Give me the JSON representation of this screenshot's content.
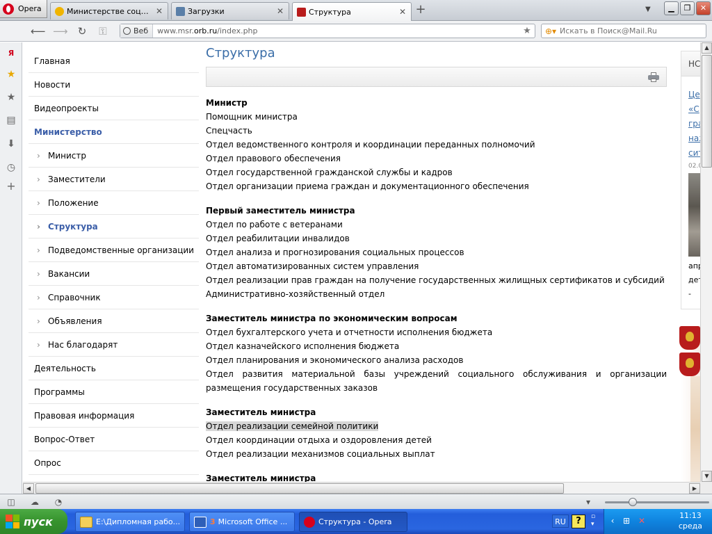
{
  "browser": {
    "menu_label": "Opera",
    "tabs": [
      {
        "label": "Министерстве социаль...",
        "close": "✕"
      },
      {
        "label": "Загрузки",
        "close": "✕"
      },
      {
        "label": "Структура",
        "close": "✕"
      }
    ],
    "new_tab": "+",
    "address": {
      "badge": "Веб",
      "url_prefix": "www.msr.",
      "url_domain": "orb.ru",
      "url_suffix": "/index.php"
    },
    "search": {
      "placeholder": "Искать в Поиск@Mail.Ru"
    }
  },
  "panel_icons": [
    "yandex-icon",
    "star-bookmarks-icon",
    "star-icon",
    "notes-icon",
    "downloads-icon",
    "history-icon",
    "add-panel-icon"
  ],
  "leftnav": {
    "items": [
      {
        "label": "Главная",
        "level": 0,
        "active": false
      },
      {
        "label": "Новости",
        "level": 0,
        "active": false
      },
      {
        "label": "Видеопроекты",
        "level": 0,
        "active": false
      },
      {
        "label": "Министерство",
        "level": 0,
        "active": true
      },
      {
        "label": "Министр",
        "level": 1,
        "active": false
      },
      {
        "label": "Заместители",
        "level": 1,
        "active": false
      },
      {
        "label": "Положение",
        "level": 1,
        "active": false
      },
      {
        "label": "Структура",
        "level": 1,
        "active": true
      },
      {
        "label": "Подведомственные организации",
        "level": 1,
        "active": false
      },
      {
        "label": "Вакансии",
        "level": 1,
        "active": false
      },
      {
        "label": "Справочник",
        "level": 1,
        "active": false
      },
      {
        "label": "Объявления",
        "level": 1,
        "active": false
      },
      {
        "label": "Нас благодарят",
        "level": 1,
        "active": false
      },
      {
        "label": "Деятельность",
        "level": 0,
        "active": false
      },
      {
        "label": "Программы",
        "level": 0,
        "active": false
      },
      {
        "label": "Правовая информация",
        "level": 0,
        "active": false
      },
      {
        "label": "Вопрос-Ответ",
        "level": 0,
        "active": false
      },
      {
        "label": "Опрос",
        "level": 0,
        "active": false
      }
    ]
  },
  "content": {
    "title": "Структура",
    "sections": [
      {
        "head": "Министр",
        "departments": [
          "Помощник министра",
          "Спецчасть",
          "Отдел ведомственного контроля и координации переданных полномочий",
          "Отдел правового обеспечения",
          "Отдел государственной гражданской службы и кадров",
          "Отдел организации приема граждан и документационного обеспечения"
        ]
      },
      {
        "head": "Первый заместитель министра",
        "departments": [
          "Отдел по работе с ветеранами",
          "Отдел реабилитации инвалидов",
          "Отдел анализа и прогнозирования социальных процессов",
          "Отдел автоматизированных систем управления",
          "Отдел реализации прав граждан на получение государственных жилищных сертификатов и субсидий",
          "Административно-хозяйственный отдел"
        ]
      },
      {
        "head": "Заместитель министра по экономическим вопросам",
        "departments": [
          "Отдел бухгалтерского учета и отчетности исполнения бюджета",
          "Отдел казначейского исполнения бюджета",
          "Отдел планирования и экономического анализа расходов",
          "Отдел развития материальной базы учреждений социального обслуживания и организации размещения государственных заказов"
        ]
      },
      {
        "head": "Заместитель министра",
        "departments": [
          "Отдел реализации семейной политики",
          "Отдел координации отдыха и оздоровления детей",
          "Отдел реализации механизмов социальных выплат"
        ],
        "selected_index": 0
      },
      {
        "head": "Заместитель министра",
        "departments": []
      }
    ]
  },
  "right_column": {
    "news_head": "НС",
    "links": [
      "Це",
      "«С",
      "гра",
      "наж",
      "сит"
    ],
    "date": "02.0",
    "tail": [
      "апр",
      "дет",
      "-"
    ]
  },
  "statusbar_icons": [
    "panel-toggle-icon",
    "opera-unite-icon",
    "speed-dial-icon"
  ],
  "taskbar": {
    "start": "пуск",
    "tasks": [
      {
        "label": "E:\\Дипломная рабо..."
      },
      {
        "label": "Microsoft Office ...",
        "count": "3"
      },
      {
        "label": "Структура - Opera"
      }
    ],
    "lang": "RU",
    "help": "?",
    "time": "11:13",
    "day": "среда"
  },
  "colors": {
    "accent": "#3b6ea8",
    "nav_active": "#3b5ea8",
    "selection": "#d7d7d7"
  }
}
